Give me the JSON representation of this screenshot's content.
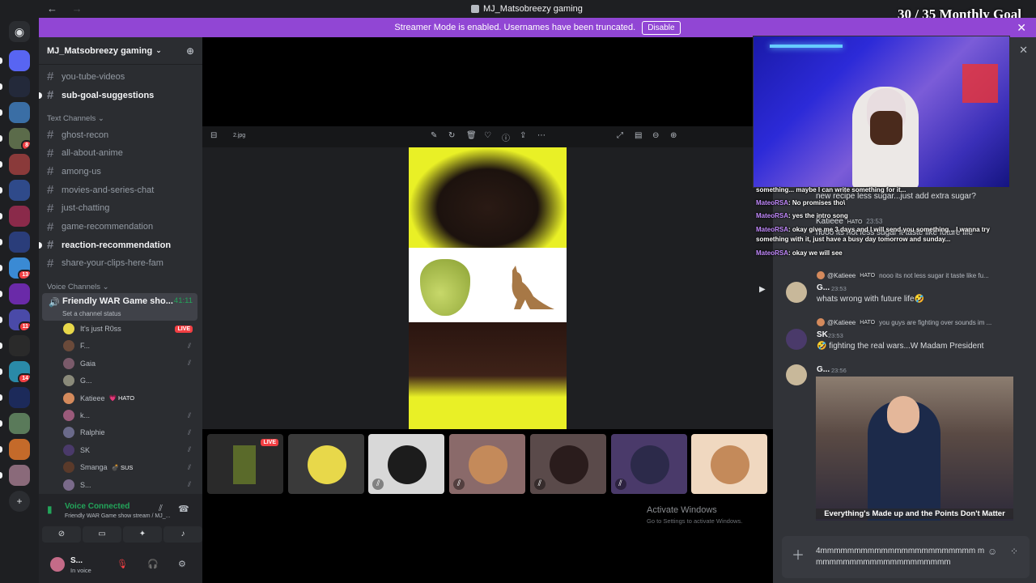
{
  "window": {
    "title": "MJ_Matsobreezy gaming",
    "back": "←",
    "forward": "→"
  },
  "overlay": {
    "goal": "30 / 35 Monthly Goal"
  },
  "banner": {
    "text": "Streamer Mode is enabled. Usernames have been truncated.",
    "button": "Disable",
    "close": "✕"
  },
  "servers": [
    {
      "color": "#5865f2",
      "badge": ""
    },
    {
      "color": "#23293a",
      "badge": ""
    },
    {
      "color": "#3a6ea5",
      "badge": ""
    },
    {
      "color": "#5b6b4a",
      "badge": "8"
    },
    {
      "color": "#8a3a3a",
      "badge": ""
    },
    {
      "color": "#2f4a8a",
      "badge": ""
    },
    {
      "color": "#8a2a4a",
      "badge": ""
    },
    {
      "color": "#2a3d7a",
      "badge": ""
    },
    {
      "color": "#3a8ad4",
      "badge": "13"
    },
    {
      "color": "#6a2aa8",
      "badge": ""
    },
    {
      "color": "#4a4aa8",
      "badge": "11"
    },
    {
      "color": "#2a2a2a",
      "badge": ""
    },
    {
      "color": "#2a8aa8",
      "badge": "14"
    },
    {
      "color": "#1c2a5a",
      "badge": ""
    },
    {
      "color": "#5a7a5a",
      "badge": ""
    },
    {
      "color": "#c46a2a",
      "badge": ""
    },
    {
      "color": "#8a6a7a",
      "badge": ""
    }
  ],
  "sidebar": {
    "server_name": "MJ_Matsobreezy gaming",
    "top_channels": [
      {
        "name": "you-tube-videos",
        "unread": false
      },
      {
        "name": "sub-goal-suggestions",
        "unread": true
      }
    ],
    "text_category": "Text Channels",
    "text_channels": [
      {
        "name": "ghost-recon",
        "unread": false
      },
      {
        "name": "all-about-anime",
        "unread": false
      },
      {
        "name": "among-us",
        "unread": false
      },
      {
        "name": "movies-and-series-chat",
        "unread": false
      },
      {
        "name": "just-chatting",
        "unread": false
      },
      {
        "name": "game-recommendation",
        "unread": false
      },
      {
        "name": "reaction-recommendation",
        "unread": true
      },
      {
        "name": "share-your-clips-here-fam",
        "unread": false
      }
    ],
    "voice_category": "Voice Channels",
    "voice_channel": {
      "name": "Friendly WAR Game sho...",
      "time": "41:11",
      "status": "Set a channel status"
    },
    "members": [
      {
        "name": "It's just R0ss",
        "color": "#e8d84a",
        "live": "LIVE",
        "muted": false,
        "tag": ""
      },
      {
        "name": "F...",
        "color": "#6a4a3a",
        "live": "",
        "muted": true,
        "tag": ""
      },
      {
        "name": "Gaia",
        "color": "#7a5a6a",
        "live": "",
        "muted": true,
        "tag": ""
      },
      {
        "name": "G...",
        "color": "#8a8a7a",
        "live": "",
        "muted": false,
        "tag": ""
      },
      {
        "name": "Katieee",
        "color": "#d48a5c",
        "live": "",
        "muted": false,
        "tag": "💗 HATO"
      },
      {
        "name": "k...",
        "color": "#9a5a7a",
        "live": "",
        "muted": true,
        "tag": ""
      },
      {
        "name": "Ralphie",
        "color": "#6a6a8a",
        "live": "",
        "muted": true,
        "tag": ""
      },
      {
        "name": "SK",
        "color": "#4a3a6a",
        "live": "",
        "muted": true,
        "tag": ""
      },
      {
        "name": "Smanga",
        "color": "#5a3a2a",
        "live": "",
        "muted": true,
        "tag": "💣 SUS"
      },
      {
        "name": "S...",
        "color": "#7a6a8a",
        "live": "",
        "muted": true,
        "tag": ""
      }
    ],
    "voice_panel": {
      "status": "Voice Connected",
      "channel": "Friendly WAR Game show stream / MJ_..."
    },
    "user": {
      "name": "S...",
      "status": "In voice"
    }
  },
  "viewer": {
    "file_name": "2.jpg",
    "activate_title": "Activate Windows",
    "activate_sub": "Go to Settings to activate Windows."
  },
  "tiles": [
    {
      "bg": "#2a2a2a",
      "portrait": "",
      "live": "LIVE",
      "mic": false
    },
    {
      "bg": "#3a3a3a",
      "portrait": "#e8d84a",
      "live": "",
      "mic": false
    },
    {
      "bg": "#d8d8d8",
      "portrait": "#1c1c1c",
      "live": "",
      "mic": true
    },
    {
      "bg": "#8a6a6a",
      "portrait": "#c48a5a",
      "live": "",
      "mic": true
    },
    {
      "bg": "#5a4a4a",
      "portrait": "#2a1c1c",
      "live": "",
      "mic": true
    },
    {
      "bg": "#4a3a6a",
      "portrait": "#2c2a4a",
      "live": "",
      "mic": true
    },
    {
      "bg": "#f0d8c0",
      "portrait": "#c48a5a",
      "live": "",
      "mic": false
    }
  ],
  "overlay_chat": [
    {
      "name": "",
      "text": "something... maybe I can write something for it..."
    },
    {
      "name": "MateoRSA",
      "text": ": No promises tho\\"
    },
    {
      "name": "MateoRSA",
      "text": ": yes the intro song"
    },
    {
      "name": "MateoRSA",
      "text": ": okay give me 3 days and I will send you something... I wanna try"
    },
    {
      "name": "",
      "text": "something with it, just have a busy day tomorrow and sunday..."
    },
    {
      "name": "MateoRSA",
      "text": ": okay we will see"
    }
  ],
  "chat_ghost": {
    "line1": "new recipe less sugar...just add extra sugar?",
    "name": "Katieee",
    "tag": "HATO",
    "time": "23:53",
    "line2": "nooo its not less sugar it taste like future life"
  },
  "messages": [
    {
      "reply_name": "@Katieee",
      "reply_tag": "HATO",
      "reply_text": "nooo its not less sugar it taste like fu...",
      "name": "G...",
      "time": "23:53",
      "text": "whats wrong with future life🤣",
      "av": "#c8b89a"
    },
    {
      "reply_name": "@Katieee",
      "reply_tag": "HATO",
      "reply_text": "you guys are fighting over sounds im ...",
      "name": "SK",
      "time": "23:53",
      "text": "🤣 fighting the real wars...W Madam President",
      "av": "#4a3a6a"
    },
    {
      "reply_name": "",
      "reply_tag": "",
      "reply_text": "",
      "name": "G...",
      "time": "23:56",
      "text": "",
      "av": "#c8b89a"
    }
  ],
  "gif_caption": "Everything's Made up and the Points Don't Matter",
  "input": {
    "text": "4mmmmmmmmmmmmmmmmmmmmmmm mmmmmmmmmmmmmmmmmmmmm"
  }
}
